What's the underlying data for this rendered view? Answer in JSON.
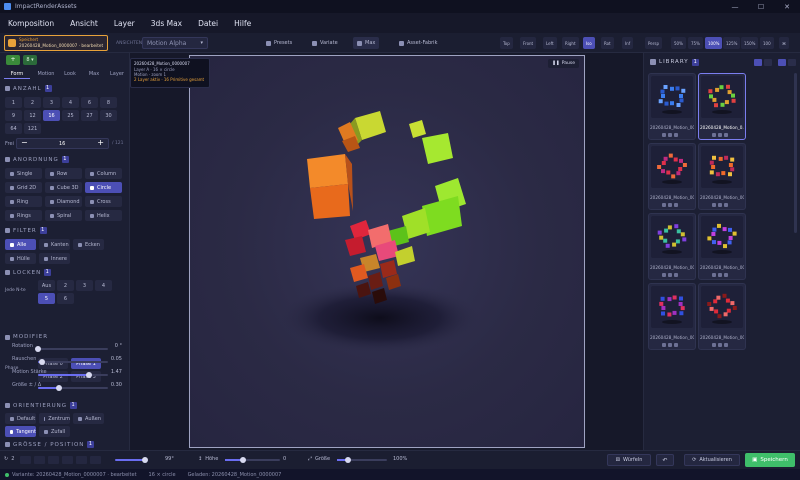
{
  "window": {
    "title": "ImpactRenderAssets"
  },
  "menu": [
    "Komposition",
    "Ansicht",
    "Layer",
    "3ds Max",
    "Datei",
    "Hilfe"
  ],
  "toolbar": {
    "project_label": "Speichert",
    "project_name": "20260428_Motion_0000007 · bearbeitet",
    "btn_plus_label": "+",
    "btn_count_label": "8 ▾",
    "mode_label": "Motion Alpha",
    "mode_prefix": "ANSICHTEN",
    "center_tabs": [
      "Presets",
      "Variate",
      "Max",
      "Asset-Fabrik"
    ],
    "view_buttons": [
      "Top",
      "Front",
      "Left",
      "Right",
      "Iso",
      "Rot",
      "Inf",
      "Persp"
    ],
    "zoom_buttons": [
      "50%",
      "75%",
      "100%",
      "125%",
      "150%",
      "100",
      "⌘"
    ]
  },
  "left": {
    "tabs": [
      "Form",
      "Motion",
      "Look",
      "Max",
      "Layer"
    ],
    "anzahl": {
      "title": "ANZAHL",
      "badge": "1",
      "options": [
        "1",
        "2",
        "3",
        "4",
        "6",
        "8",
        "9",
        "12",
        "16",
        "25",
        "27",
        "30",
        "64",
        "121"
      ],
      "selected": "16"
    },
    "frei": {
      "label": "Frei",
      "value": "16",
      "minus": "−",
      "plus": "+",
      "max": "/ 121"
    },
    "anordnung": {
      "title": "ANORDNUNG",
      "badge": "1",
      "options": [
        "Single",
        "Row",
        "Column",
        "Grid 2D",
        "Cube 3D",
        "Circle",
        "Ring",
        "Diamond",
        "Cross",
        "Rings",
        "Spiral",
        "Helix"
      ],
      "selected": "Circle"
    },
    "filter": {
      "title": "FILTER",
      "badge": "1",
      "options": [
        "Alle",
        "Kanten",
        "Ecken",
        "Hülle",
        "Innere"
      ],
      "selected": "Alle"
    },
    "locken": {
      "title": "LOCKEN",
      "badge": "1",
      "jede_label": "Jede N-te",
      "n_options": [
        "Aus",
        "2",
        "3",
        "4",
        "5",
        "6"
      ],
      "selected": "5",
      "phase_label": "Phase",
      "phase_options": [
        "Phase 0",
        "Phase 1",
        "Phase 2",
        "Phase 3"
      ],
      "phase_selected": "Phase 1"
    },
    "modifier": {
      "title": "MODIFIER",
      "sliders": [
        {
          "label": "Rotation",
          "value": "0 °",
          "fraction": 0.0
        },
        {
          "label": "Rauschen",
          "value": "0.05",
          "fraction": 0.05
        },
        {
          "label": "Motion Stärke",
          "value": "1.47",
          "fraction": 0.73
        },
        {
          "label": "Größe ± / Δ",
          "value": "0.30",
          "fraction": 0.3
        }
      ]
    },
    "orientierung": {
      "title": "ORIENTIERUNG",
      "badge": "1",
      "options": [
        "Default",
        "Zentrum",
        "Außen",
        "Tangent",
        "Zufall"
      ],
      "selected": "Tangent"
    },
    "groesse": {
      "title": "GRÖSSE / POSITION",
      "badge": "1"
    }
  },
  "viewport": {
    "info_name": "20260428_Motion_0000007",
    "info_line1": "Layer A · 16 × circle",
    "info_line2": "Motion · zoom 1",
    "info_line3": "2 Layer aktiv · 16 Primitive gesamt",
    "pause_label": "Pause"
  },
  "library": {
    "title": "LIBRARY",
    "badge": "1",
    "cards": [
      {
        "name": "20260428_Motion_000..."
      },
      {
        "name": "20260428_Motion_0..."
      },
      {
        "name": "20260428_Motion_000..."
      },
      {
        "name": "20260428_Motion_000..."
      },
      {
        "name": "20260428_Motion_000..."
      },
      {
        "name": "20260428_Motion_000..."
      },
      {
        "name": "20260428_Motion_000..."
      },
      {
        "name": "20260428_Motion_000..."
      }
    ],
    "selected_index": 1
  },
  "bottom": {
    "frame_start": "2",
    "frame_value": "99°",
    "hoehe_label": "Höhe",
    "hoehe_value": "0",
    "groesse_label": "Größe",
    "groesse_value": "100%",
    "wuerfeln_label": "Würfeln",
    "aktualisieren_label": "Aktualisieren",
    "speichern_label": "Speichern"
  },
  "status": {
    "left": "Variante: 20260428_Motion_0000007 · bearbeitet",
    "mid": "16 × circle",
    "right": "Geladen: 20260428_Motion_0000007"
  },
  "colors": {
    "accent": "#4c4fb5",
    "save": "#3fbf6a",
    "project": "#e8a23a"
  }
}
